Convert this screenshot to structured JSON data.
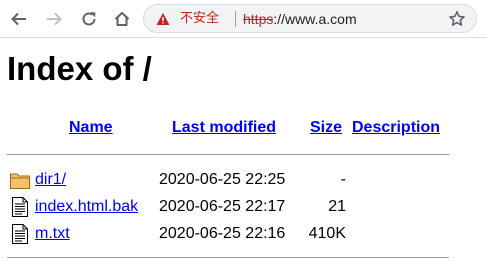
{
  "browser": {
    "security_label": "不安全",
    "url_scheme": "https",
    "url_rest": "://www.a.com",
    "icons": {
      "back": "arrow-left-icon",
      "forward": "arrow-right-icon",
      "reload": "reload-icon",
      "home": "home-icon",
      "warning": "warning-triangle-icon",
      "bookmark": "star-icon"
    }
  },
  "page": {
    "title": "Index of /"
  },
  "table": {
    "headers": {
      "name": "Name",
      "modified": "Last modified",
      "size": "Size",
      "description": "Description"
    },
    "rows": [
      {
        "icon": "folder-icon",
        "name": "dir1/",
        "modified": "2020-06-25 22:25",
        "size": "-",
        "description": ""
      },
      {
        "icon": "file-icon",
        "name": "index.html.bak",
        "modified": "2020-06-25 22:17",
        "size": "21",
        "description": ""
      },
      {
        "icon": "file-icon",
        "name": "m.txt",
        "modified": "2020-06-25 22:16",
        "size": "410K",
        "description": ""
      }
    ]
  },
  "colors": {
    "link": "#0000ee",
    "insecure": "#c5221f",
    "folder": "#e8a93c"
  }
}
